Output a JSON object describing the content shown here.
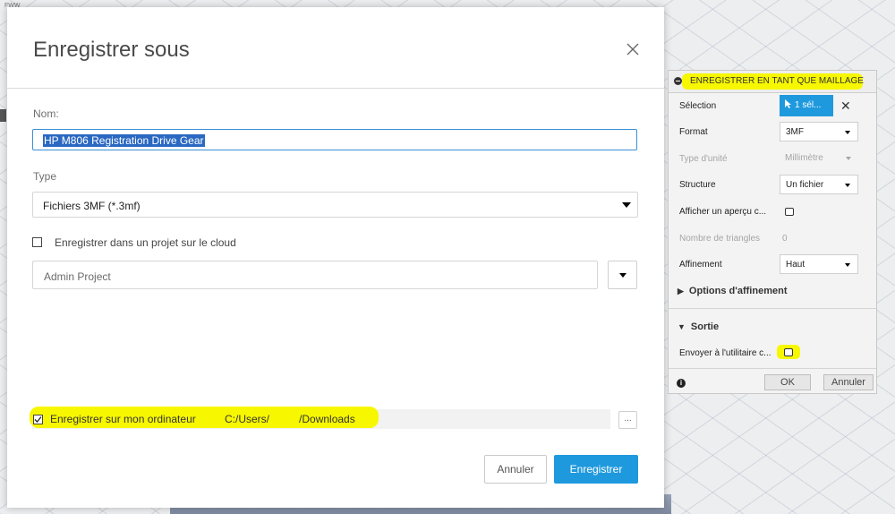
{
  "background": {
    "corner_label": "FWW"
  },
  "dialog": {
    "title": "Enregistrer sous",
    "name_label": "Nom:",
    "name_value": "HP M806 Registration Drive Gear",
    "type_label": "Type",
    "type_value": "Fichiers 3MF (*.3mf)",
    "cloud_checkbox_label": "Enregistrer dans un projet sur le cloud",
    "cloud_checked": false,
    "project_value": "Admin Project",
    "save_local_label": "Enregistrer sur mon ordinateur",
    "save_local_checked": true,
    "path_prefix": "C:/Users/",
    "path_suffix": "/Downloads",
    "browse_label": "...",
    "cancel_label": "Annuler",
    "save_label": "Enregistrer"
  },
  "panel": {
    "title": "ENREGISTRER EN TANT QUE MAILLAGE",
    "selection_label": "Sélection",
    "selection_value": "1 sél...",
    "format_label": "Format",
    "format_value": "3MF",
    "unit_label": "Type d'unité",
    "unit_value": "Millimètre",
    "structure_label": "Structure",
    "structure_value": "Un fichier",
    "preview_label": "Afficher un aperçu c...",
    "triangles_label": "Nombre de triangles",
    "triangles_value": "0",
    "refinement_label": "Affinement",
    "refinement_value": "Haut",
    "refinement_options_label": "Options d'affinement",
    "output_label": "Sortie",
    "send_utility_label": "Envoyer à l'utilitaire c...",
    "ok_label": "OK",
    "cancel_label": "Annuler"
  },
  "colors": {
    "accent": "#1f99dd",
    "highlight": "#f7f700"
  }
}
